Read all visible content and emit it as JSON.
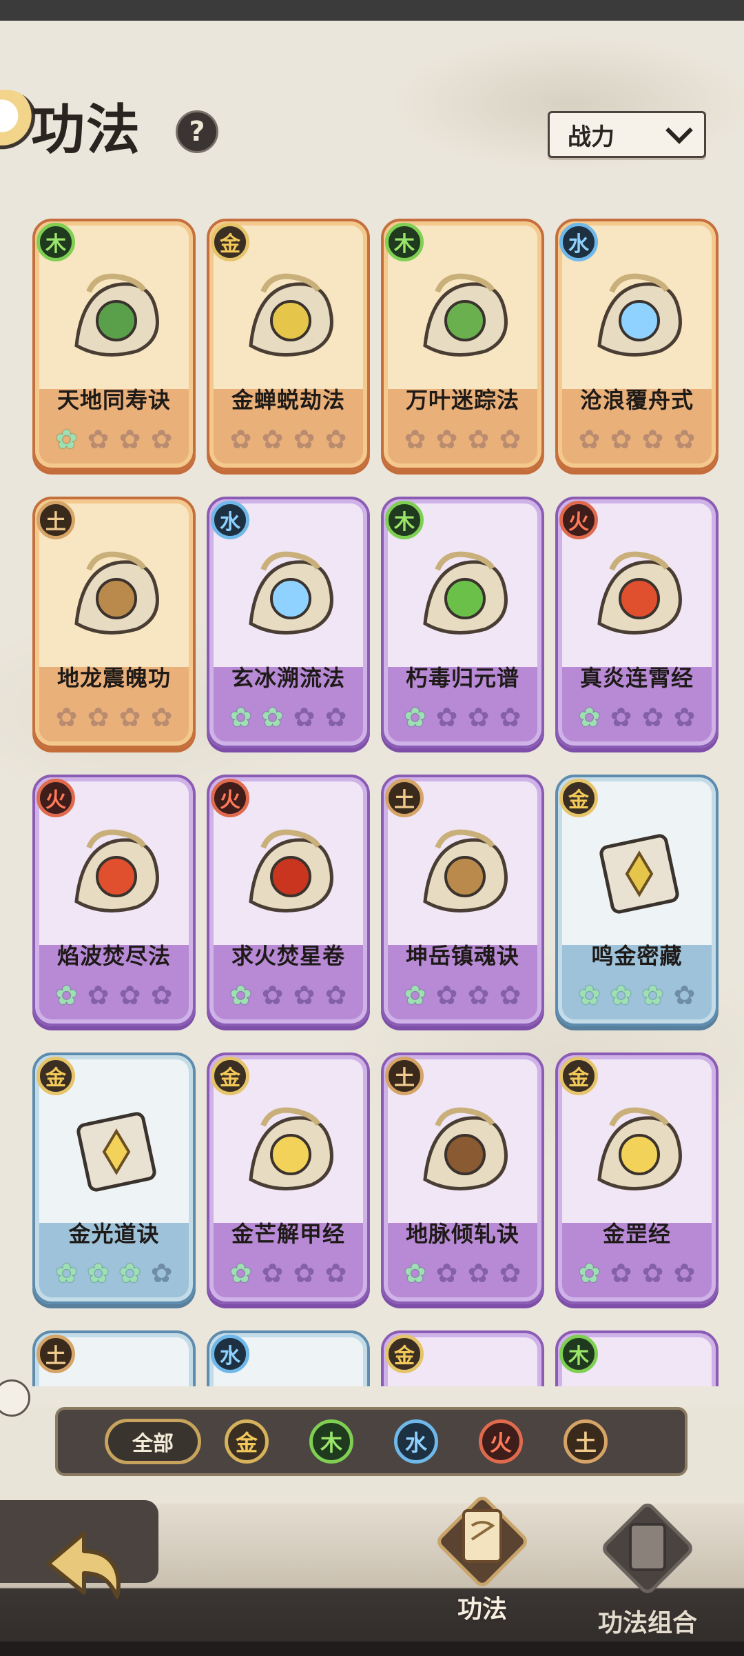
{
  "header": {
    "title": "功法",
    "help_label": "?"
  },
  "sort": {
    "label": "战力"
  },
  "cards": [
    {
      "name": "天地同寿诀",
      "element": "木",
      "etype": "wood",
      "rarity": "orange",
      "stars": 1,
      "icon": "green-relic-icon",
      "art_color": "#5aa04a"
    },
    {
      "name": "金蝉蜕劫法",
      "element": "金",
      "etype": "metal",
      "rarity": "orange",
      "stars": 0,
      "icon": "golden-cicada-icon",
      "art_color": "#e6c64a"
    },
    {
      "name": "万叶迷踪法",
      "element": "木",
      "etype": "wood",
      "rarity": "orange",
      "stars": 0,
      "icon": "leaf-maze-icon",
      "art_color": "#6bb04e"
    },
    {
      "name": "沧浪覆舟式",
      "element": "水",
      "etype": "water",
      "rarity": "orange",
      "stars": 0,
      "icon": "water-wave-icon",
      "art_color": "#8fd2ff"
    },
    {
      "name": "地龙震魄功",
      "element": "土",
      "etype": "earth",
      "rarity": "orange",
      "stars": 0,
      "icon": "earth-dragon-icon",
      "art_color": "#b98a4c"
    },
    {
      "name": "玄冰溯流法",
      "element": "水",
      "etype": "water",
      "rarity": "purple",
      "stars": 2,
      "icon": "ice-stream-icon",
      "art_color": "#8fd2ff"
    },
    {
      "name": "朽毒归元谱",
      "element": "木",
      "etype": "wood",
      "rarity": "purple",
      "stars": 1,
      "icon": "poison-skull-icon",
      "art_color": "#6bc04a"
    },
    {
      "name": "真炎连霄经",
      "element": "火",
      "etype": "fire",
      "rarity": "purple",
      "stars": 1,
      "icon": "flame-scroll-icon",
      "art_color": "#e0502e"
    },
    {
      "name": "焰波焚尽法",
      "element": "火",
      "etype": "fire",
      "rarity": "purple",
      "stars": 1,
      "icon": "fire-wave-icon",
      "art_color": "#e0502e"
    },
    {
      "name": "求火焚星卷",
      "element": "火",
      "etype": "fire",
      "rarity": "purple",
      "stars": 1,
      "icon": "fire-star-icon",
      "art_color": "#c9351e"
    },
    {
      "name": "坤岳镇魂诀",
      "element": "土",
      "etype": "earth",
      "rarity": "purple",
      "stars": 1,
      "icon": "mountain-icon",
      "art_color": "#b98a4c"
    },
    {
      "name": "鸣金密藏",
      "element": "金",
      "etype": "metal",
      "rarity": "blue",
      "stars": 3,
      "icon": "metal-book-icon",
      "art_color": "#e6c64a"
    },
    {
      "name": "金光道诀",
      "element": "金",
      "etype": "metal",
      "rarity": "blue",
      "stars": 3,
      "icon": "gold-light-book-icon",
      "art_color": "#f3d25a"
    },
    {
      "name": "金芒解甲经",
      "element": "金",
      "etype": "metal",
      "rarity": "purple",
      "stars": 1,
      "icon": "gold-blade-icon",
      "art_color": "#f3d25a"
    },
    {
      "name": "地脉倾轧诀",
      "element": "土",
      "etype": "earth",
      "rarity": "purple",
      "stars": 1,
      "icon": "earth-vein-icon",
      "art_color": "#8a5a32"
    },
    {
      "name": "金罡经",
      "element": "金",
      "etype": "metal",
      "rarity": "purple",
      "stars": 1,
      "icon": "gold-arrow-icon",
      "art_color": "#f3d25a"
    },
    {
      "name": "",
      "element": "土",
      "etype": "earth",
      "rarity": "blue",
      "stars": 0,
      "icon": "",
      "art_color": ""
    },
    {
      "name": "",
      "element": "水",
      "etype": "water",
      "rarity": "blue",
      "stars": 0,
      "icon": "",
      "art_color": ""
    },
    {
      "name": "",
      "element": "金",
      "etype": "metal",
      "rarity": "purple",
      "stars": 0,
      "icon": "",
      "art_color": ""
    },
    {
      "name": "",
      "element": "木",
      "etype": "wood",
      "rarity": "purple",
      "stars": 0,
      "icon": "",
      "art_color": ""
    }
  ],
  "filters": {
    "all": "全部",
    "elements": [
      {
        "label": "金",
        "etype": "metal"
      },
      {
        "label": "木",
        "etype": "wood"
      },
      {
        "label": "水",
        "etype": "water"
      },
      {
        "label": "火",
        "etype": "fire"
      },
      {
        "label": "土",
        "etype": "earth"
      }
    ]
  },
  "nav": {
    "item1": "功法",
    "item2": "功法组合"
  },
  "colors": {
    "orange_card": "#eab07a",
    "purple_card": "#b88ad6",
    "blue_card": "#9ec2d9",
    "star_on": "#9ee0b3"
  }
}
